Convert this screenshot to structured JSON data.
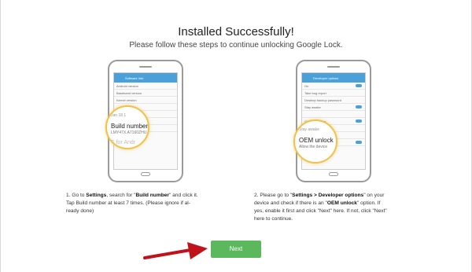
{
  "header": {
    "title": "Installed Successfully!",
    "subtitle": "Please follow these steps to continue unlocking Google Lock."
  },
  "left_phone": {
    "appbar": "Software info",
    "rows": [
      "Android version",
      "Baseband version",
      "Kernel version",
      "",
      "Build number",
      "",
      "SE for Android status"
    ],
    "magnifier": {
      "top": "Jan 18 1",
      "main": "Build number",
      "sub": "LMY47X.A7160ZHU",
      "bottom": "E for Andr"
    }
  },
  "right_phone": {
    "appbar": "Developer options",
    "rows": [
      "On",
      "Take bug report",
      "Desktop backup password",
      "Stay awake",
      "",
      "OEM unlocking",
      "",
      "Debug",
      "USB debugging"
    ],
    "magnifier": {
      "top": "Stay awake",
      "main": "OEM unlock",
      "sub": "Allow the device"
    }
  },
  "steps": {
    "step1": {
      "a": "1. Go to ",
      "b1": "Settings",
      "c": ", search for \"",
      "b2": "Build number",
      "d": "\" and click it.",
      "e": "Tap Build number at least 7 times. (Please ignore if al-",
      "f": "ready done)"
    },
    "step2": {
      "a": "2. Please go to \"",
      "b1": "Settings > Developer options",
      "c": "\" on your",
      "d1": "device and check if there is an \"",
      "b2": "OEM unlock",
      "d2": "\" option. If",
      "e": "yes, enable it first and click \"Next\" here. If not, click \"Next\"",
      "f": "here to continue."
    }
  },
  "actions": {
    "next_label": "Next"
  },
  "colors": {
    "accent_button": "#5cb85c",
    "arrow": "#c0121a",
    "highlight_ring": "#f0c24b"
  }
}
